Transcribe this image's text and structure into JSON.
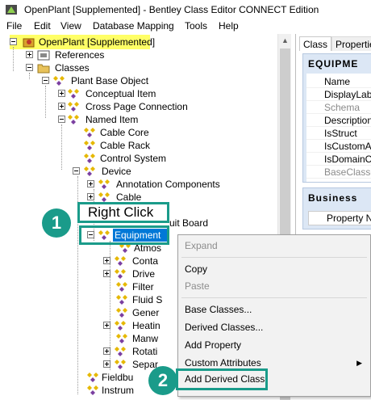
{
  "window": {
    "title": "OpenPlant [Supplemented] - Bentley Class Editor CONNECT Edition"
  },
  "menubar": [
    "File",
    "Edit",
    "View",
    "Database Mapping",
    "Tools",
    "Help"
  ],
  "tree": {
    "root": "OpenPlant [Supplemented]",
    "references": "References",
    "classes": "Classes",
    "plant_base_object": "Plant Base Object",
    "conceptual_item": "Conceptual Item",
    "cross_page_connection": "Cross Page Connection",
    "named_item": "Named Item",
    "cable_core": "Cable Core",
    "cable_rack": "Cable Rack",
    "control_system": "Control System",
    "device": "Device",
    "annotation_components": "Annotation Components",
    "cable": "Cable",
    "circuit_board_partial": "uit Board",
    "equipment": "Equipment",
    "children_partial": [
      "Atmos",
      "Conta",
      "Drive",
      "Filter",
      "Fluid S",
      "Gener",
      "Heatin",
      "Manw",
      "Rotati",
      "Separ"
    ],
    "fieldbus_partial": "Fieldbu",
    "instrument_partial": "Instrum"
  },
  "right_panel": {
    "tabs": [
      "Class",
      "Propertie"
    ],
    "group1_title": "EQUIPME",
    "properties": [
      {
        "label": "Name",
        "dim": false
      },
      {
        "label": "DisplayLabe",
        "dim": false
      },
      {
        "label": "Schema",
        "dim": true
      },
      {
        "label": "Description",
        "dim": false
      },
      {
        "label": "IsStruct",
        "dim": false
      },
      {
        "label": "IsCustomAt",
        "dim": false
      },
      {
        "label": "IsDomainCl",
        "dim": false
      },
      {
        "label": "BaseClasse",
        "dim": true
      }
    ],
    "group2_title": "Business",
    "property_name_header": "Property Na"
  },
  "context_menu": {
    "items": [
      {
        "label": "Expand",
        "disabled": true
      },
      {
        "label": "Copy",
        "disabled": false
      },
      {
        "label": "Paste",
        "disabled": true
      },
      {
        "label": "Base Classes...",
        "disabled": false
      },
      {
        "label": "Derived Classes...",
        "disabled": false
      },
      {
        "label": "Add Property",
        "disabled": false
      },
      {
        "label": "Custom Attributes",
        "disabled": false
      },
      {
        "label": "Add Derived Class",
        "disabled": false
      }
    ]
  },
  "callouts": {
    "step1_number": "1",
    "step1_text": "Right Click",
    "step2_number": "2"
  },
  "colors": {
    "callout_teal": "#1a9b8a",
    "root_highlight": "#ffff66",
    "selection_blue": "#0078d7"
  }
}
